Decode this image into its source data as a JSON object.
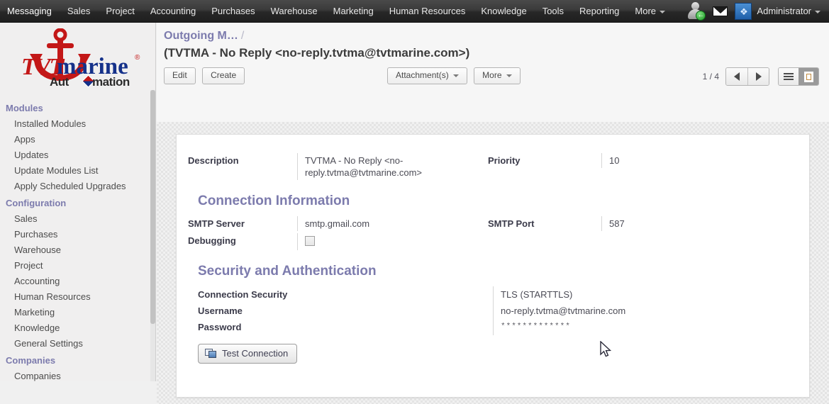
{
  "topnav": {
    "items": [
      {
        "label": "Messaging"
      },
      {
        "label": "Sales"
      },
      {
        "label": "Project"
      },
      {
        "label": "Accounting"
      },
      {
        "label": "Purchases"
      },
      {
        "label": "Warehouse"
      },
      {
        "label": "Marketing"
      },
      {
        "label": "Human Resources"
      },
      {
        "label": "Knowledge"
      },
      {
        "label": "Tools"
      },
      {
        "label": "Reporting"
      },
      {
        "label": "More"
      }
    ],
    "user_label": "Administrator",
    "icons": {
      "avatar": "user-avatar-icon",
      "mail": "envelope-icon",
      "app": "app-launcher-icon"
    },
    "background": "#2f2f2f",
    "text_color": "#e8e8e8"
  },
  "sidebar": {
    "logo": {
      "brand_tvt": "TVT",
      "brand_marine": "marine",
      "registered": "®",
      "tagline_left": "Aut",
      "tagline_right": "mation",
      "red": "#c31717",
      "blue": "#15318a"
    },
    "groups": [
      {
        "title": "Modules",
        "items": [
          {
            "label": "Installed Modules"
          },
          {
            "label": "Apps"
          },
          {
            "label": "Updates"
          },
          {
            "label": "Update Modules List"
          },
          {
            "label": "Apply Scheduled Upgrades"
          }
        ]
      },
      {
        "title": "Configuration",
        "items": [
          {
            "label": "Sales"
          },
          {
            "label": "Purchases"
          },
          {
            "label": "Warehouse"
          },
          {
            "label": "Project"
          },
          {
            "label": "Accounting"
          },
          {
            "label": "Human Resources"
          },
          {
            "label": "Marketing"
          },
          {
            "label": "Knowledge"
          },
          {
            "label": "General Settings"
          }
        ]
      },
      {
        "title": "Companies",
        "items": [
          {
            "label": "Companies"
          }
        ]
      }
    ],
    "accent_color": "#7c7bad"
  },
  "header": {
    "breadcrumb": "Outgoing M…",
    "breadcrumb_separator": "/",
    "record_title": "(TVTMA - No Reply <no-reply.tvtma@tvtmarine.com>)"
  },
  "toolbar": {
    "edit_label": "Edit",
    "create_label": "Create",
    "attachments_label": "Attachment(s)",
    "more_label": "More",
    "pager_text": "1 / 4",
    "prev_icon": "arrow-left-icon",
    "next_icon": "arrow-right-icon",
    "list_view_icon": "list-view-icon",
    "form_view_icon": "form-view-icon",
    "active_view": "form"
  },
  "form": {
    "top": {
      "description_label": "Description",
      "description_value": "TVTMA - No Reply <no-reply.tvtma@tvtmarine.com>",
      "priority_label": "Priority",
      "priority_value": "10"
    },
    "connection": {
      "section_title": "Connection Information",
      "smtp_server_label": "SMTP Server",
      "smtp_server_value": "smtp.gmail.com",
      "debugging_label": "Debugging",
      "debugging_checked": false,
      "smtp_port_label": "SMTP Port",
      "smtp_port_value": "587"
    },
    "security": {
      "section_title": "Security and Authentication",
      "connection_security_label": "Connection Security",
      "connection_security_value": "TLS (STARTTLS)",
      "username_label": "Username",
      "username_value": "no-reply.tvtma@tvtmarine.com",
      "password_label": "Password",
      "password_value": "*************"
    },
    "test_connection_label": "Test Connection"
  }
}
